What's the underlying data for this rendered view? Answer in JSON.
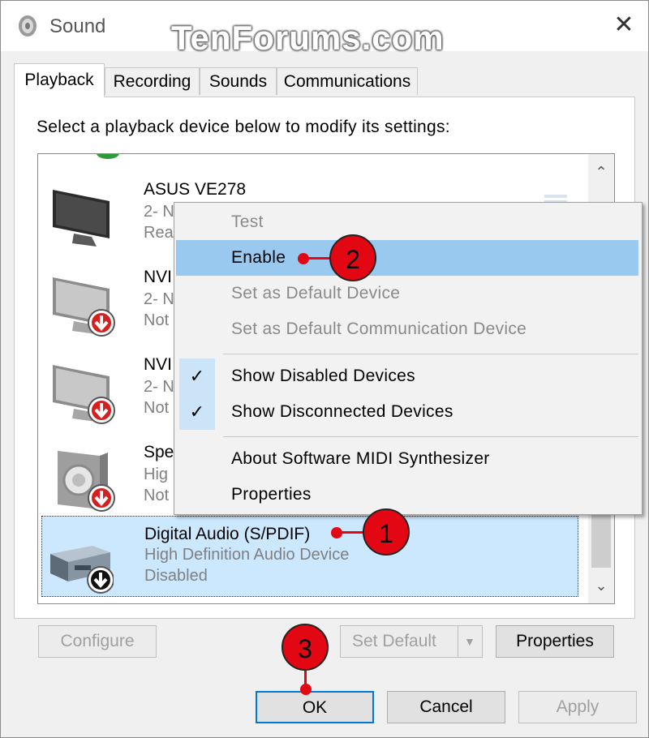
{
  "window": {
    "title": "Sound",
    "watermark": "TenForums.com",
    "close": "✕"
  },
  "tabs": [
    {
      "label": "Playback",
      "active": true
    },
    {
      "label": "Recording"
    },
    {
      "label": "Sounds"
    },
    {
      "label": "Communications"
    }
  ],
  "instruction": "Select a playback device below to modify its settings:",
  "devices": [
    {
      "name": "ASUS VE278",
      "line2": "2- N",
      "line3": "Rea",
      "icon": "monitor-icon"
    },
    {
      "name": "NVI",
      "line2": "2- N",
      "line3": "Not",
      "icon": "monitor-icon",
      "status": "disabled"
    },
    {
      "name": "NVI",
      "line2": "2- N",
      "line3": "Not",
      "icon": "monitor-icon",
      "status": "disabled"
    },
    {
      "name": "Spe",
      "line2": "Hig",
      "line3": "Not",
      "icon": "speaker-icon",
      "status": "disabled"
    },
    {
      "name": "Digital Audio (S/PDIF)",
      "line2": "High Definition Audio Device",
      "line3": "Disabled",
      "icon": "receiver-icon",
      "status": "disabled",
      "selected": true
    }
  ],
  "context_menu": {
    "items": [
      {
        "label": "Test",
        "enabled": false
      },
      {
        "label": "Enable",
        "enabled": true,
        "highlighted": true
      },
      {
        "label": "Set as Default Device",
        "enabled": false
      },
      {
        "label": "Set as Default Communication Device",
        "enabled": false
      },
      {
        "label": "Show Disabled Devices",
        "checked": true
      },
      {
        "label": "Show Disconnected Devices",
        "checked": true
      },
      {
        "label": "About Software MIDI Synthesizer"
      },
      {
        "label": "Properties"
      }
    ],
    "check_glyph": "✓"
  },
  "buttons": {
    "configure": "Configure",
    "set_default": "Set Default",
    "properties": "Properties",
    "ok": "OK",
    "cancel": "Cancel",
    "apply": "Apply"
  },
  "callouts": [
    "1",
    "2",
    "3"
  ],
  "colors": {
    "callout": "#e30613",
    "selection": "#cce8ff",
    "menu_highlight": "#99c9ef",
    "focus": "#0078d7"
  }
}
